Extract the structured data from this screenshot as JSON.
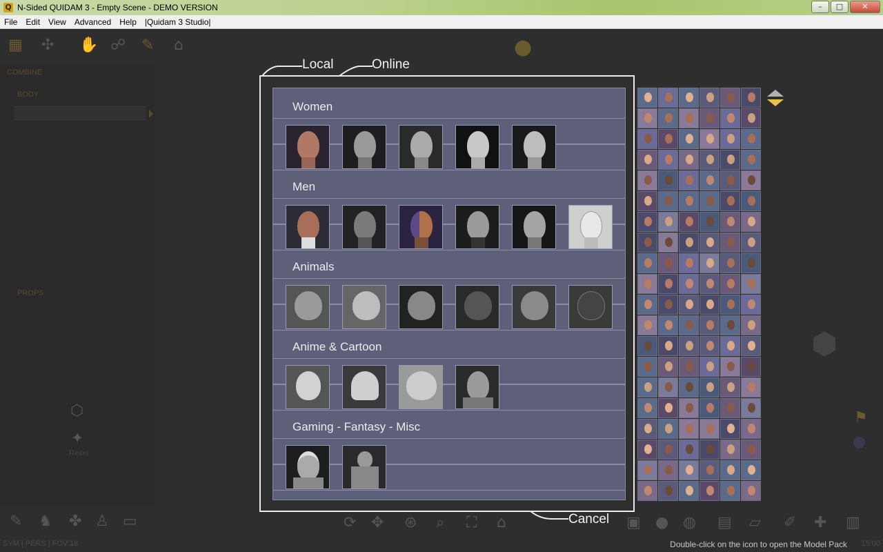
{
  "window": {
    "title": "N-Sided QUIDAM 3 - Empty Scene - DEMO VERSION",
    "app_icon": "quidam-app-icon",
    "buttons": [
      "minimize",
      "maximize",
      "close"
    ]
  },
  "menu": [
    "File",
    "Edit",
    "View",
    "Advanced",
    "Help",
    "|Quidam 3 Studio|"
  ],
  "left_panel": {
    "combine": "COMBINE",
    "body": "BODY",
    "props": "PROPS",
    "reset": "Reset"
  },
  "dialog": {
    "tabs": {
      "local": "Local",
      "online": "Online"
    },
    "cancel": "Cancel",
    "categories": [
      {
        "title": "Women",
        "items": [
          "woman-1",
          "woman-2",
          "woman-3",
          "woman-4",
          "woman-5"
        ]
      },
      {
        "title": "Men",
        "items": [
          "man-1",
          "man-2",
          "man-3",
          "man-4",
          "man-5",
          "man-6"
        ]
      },
      {
        "title": "Animals",
        "items": [
          "bulldog",
          "greyhound",
          "beagle",
          "german-shepherd",
          "dachshund",
          "cat"
        ]
      },
      {
        "title": "Anime & Cartoon",
        "items": [
          "anime-girl",
          "robot-head",
          "cartoon-creature",
          "anime-boy"
        ]
      },
      {
        "title": "Gaming - Fantasy - Misc",
        "items": [
          "fantasy-warrior",
          "muscle-man"
        ]
      }
    ]
  },
  "status": {
    "left": "SYM | PERS | FOV:18",
    "hint": "Double-click on the icon to open the Model Pack",
    "right": "15:00"
  },
  "colors": {
    "dialog_bg": "#5e5f78",
    "dialog_border": "#ececec",
    "workspace": "#2e2e2e",
    "accent_gold": "#d8b44a"
  }
}
